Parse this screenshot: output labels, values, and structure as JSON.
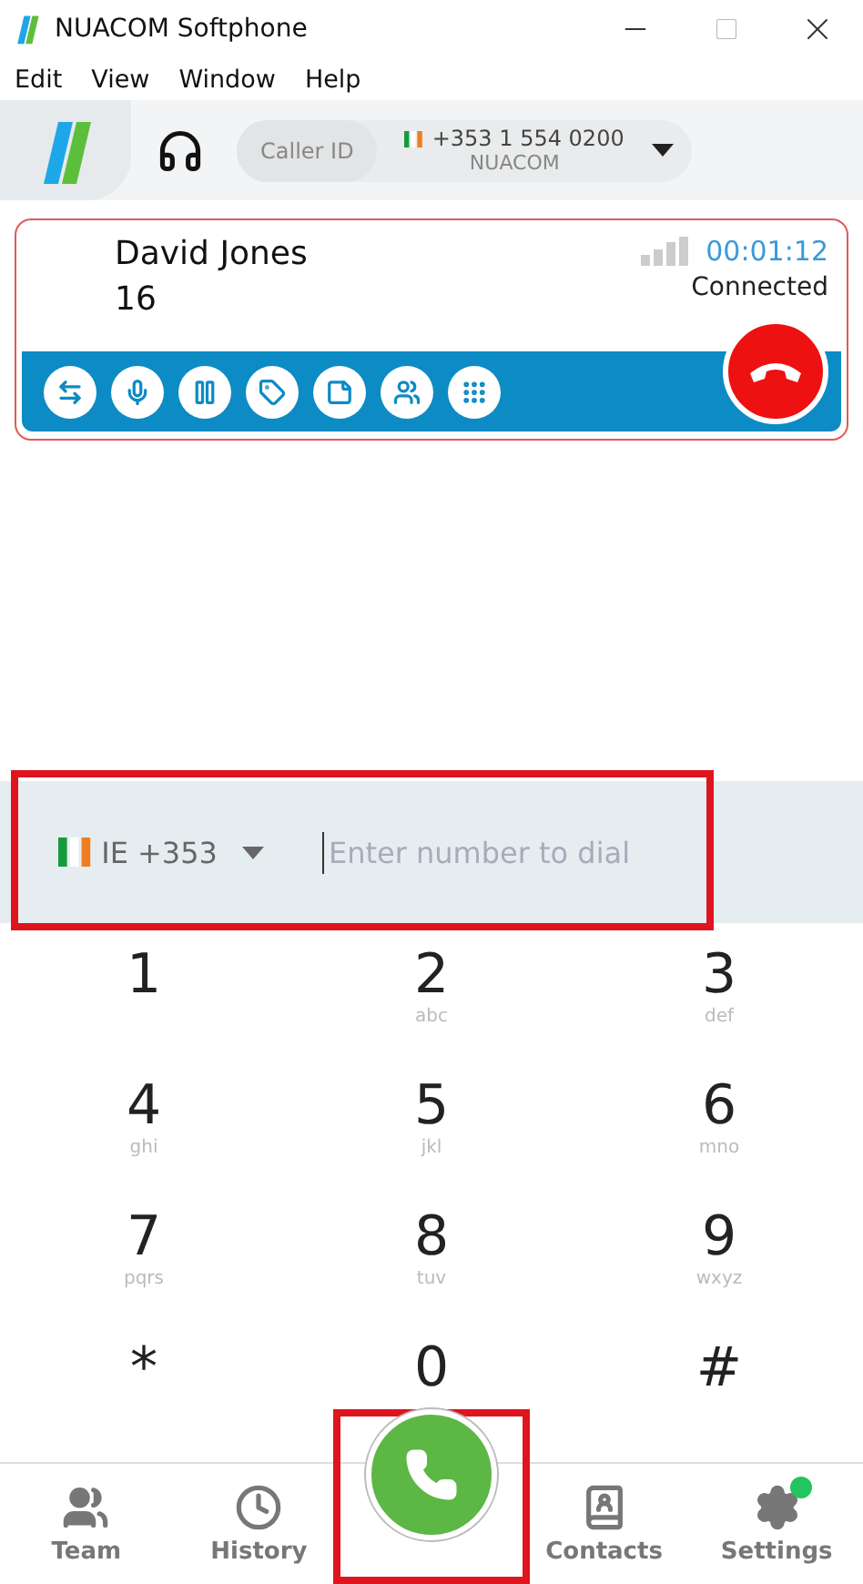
{
  "window": {
    "title": "NUACOM Softphone"
  },
  "menu": [
    "Edit",
    "View",
    "Window",
    "Help"
  ],
  "toolbar": {
    "caller_id_label": "Caller ID",
    "caller_number": "+353 1 554 0200",
    "caller_name": "NUACOM"
  },
  "call": {
    "name": "David Jones",
    "extension": "16",
    "timer": "00:01:12",
    "status": "Connected"
  },
  "dialer": {
    "country": "IE +353",
    "placeholder": "Enter number to dial",
    "highlighted": true
  },
  "keypad": [
    {
      "digit": "1"
    },
    {
      "digit": "2",
      "letters": "abc"
    },
    {
      "digit": "3",
      "letters": "def"
    },
    {
      "digit": "4",
      "letters": "ghi"
    },
    {
      "digit": "5",
      "letters": "jkl"
    },
    {
      "digit": "6",
      "letters": "mno"
    },
    {
      "digit": "7",
      "letters": "pqrs"
    },
    {
      "digit": "8",
      "letters": "tuv"
    },
    {
      "digit": "9",
      "letters": "wxyz"
    },
    {
      "digit": "*"
    },
    {
      "digit": "0"
    },
    {
      "digit": "#"
    }
  ],
  "call_button": {
    "highlighted": true
  },
  "nav": [
    {
      "label": "Team",
      "dot": false
    },
    {
      "label": "History",
      "dot": false
    },
    {
      "label": "Contacts",
      "dot": false
    },
    {
      "label": "Settings",
      "dot": true
    }
  ]
}
